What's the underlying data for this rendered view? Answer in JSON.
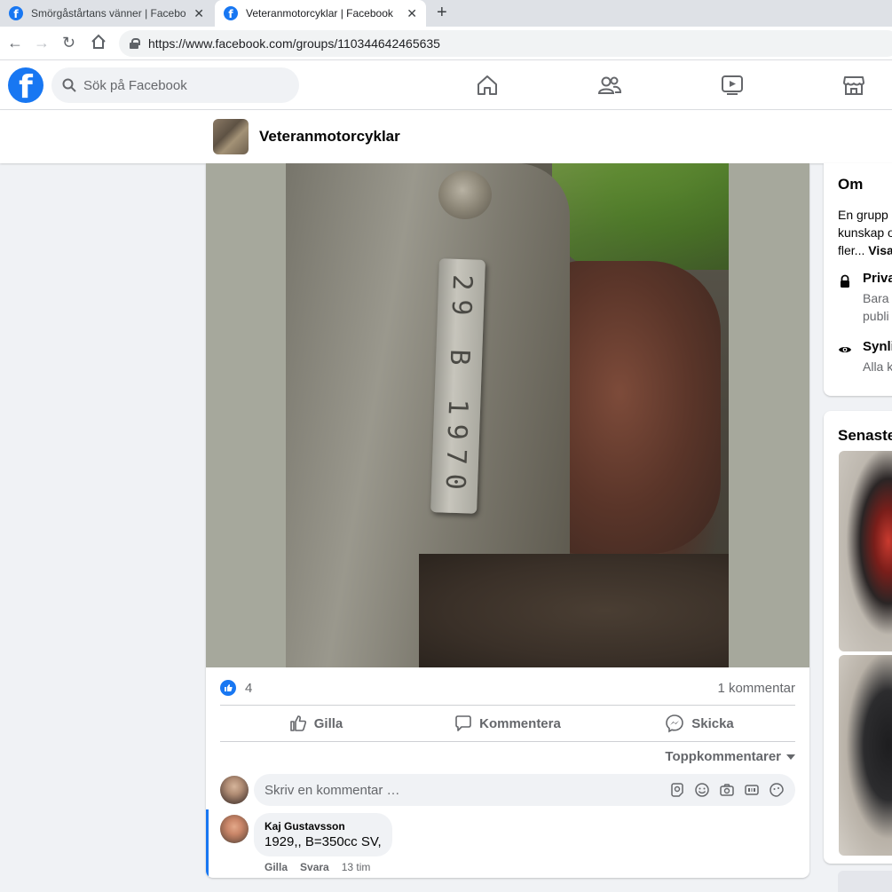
{
  "browser": {
    "tabs": [
      {
        "title": "Smörgåstårtans vänner | Facebook",
        "favicon": "f"
      },
      {
        "title": "Veteranmotorcyklar | Facebook",
        "favicon": "f"
      }
    ],
    "new_tab": "+",
    "url": "https://www.facebook.com/groups/110344642465635"
  },
  "header": {
    "logo": "f",
    "search_placeholder": "Sök på Facebook",
    "nav_icons": [
      "home-icon",
      "friends-icon",
      "watch-icon",
      "marketplace-icon"
    ],
    "brand_color": "#1877f2"
  },
  "group": {
    "name": "Veteranmotorcyklar"
  },
  "post": {
    "plate_text": "29 B 1970",
    "like_count": "4",
    "comment_count": "1 kommentar",
    "actions": {
      "like": "Gilla",
      "comment": "Kommentera",
      "send": "Skicka"
    },
    "sort_label": "Toppkommentarer",
    "comment_placeholder": "Skriv en kommentar …",
    "comments": [
      {
        "author": "Kaj Gustavsson",
        "text": "1929,, B=350cc SV,",
        "like": "Gilla",
        "reply": "Svara",
        "time": "13 tim"
      }
    ]
  },
  "sidebar": {
    "about": {
      "title": "Om",
      "desc_line1": "En grupp",
      "desc_line2": "kunskap o",
      "desc_line3_prefix": "fler... ",
      "desc_more": "Visa",
      "privacy_title": "Priva",
      "privacy_sub1": "Bara",
      "privacy_sub2": "publi",
      "visible_title": "Synli",
      "visible_sub": "Alla k"
    },
    "recent_title": "Senaste"
  }
}
